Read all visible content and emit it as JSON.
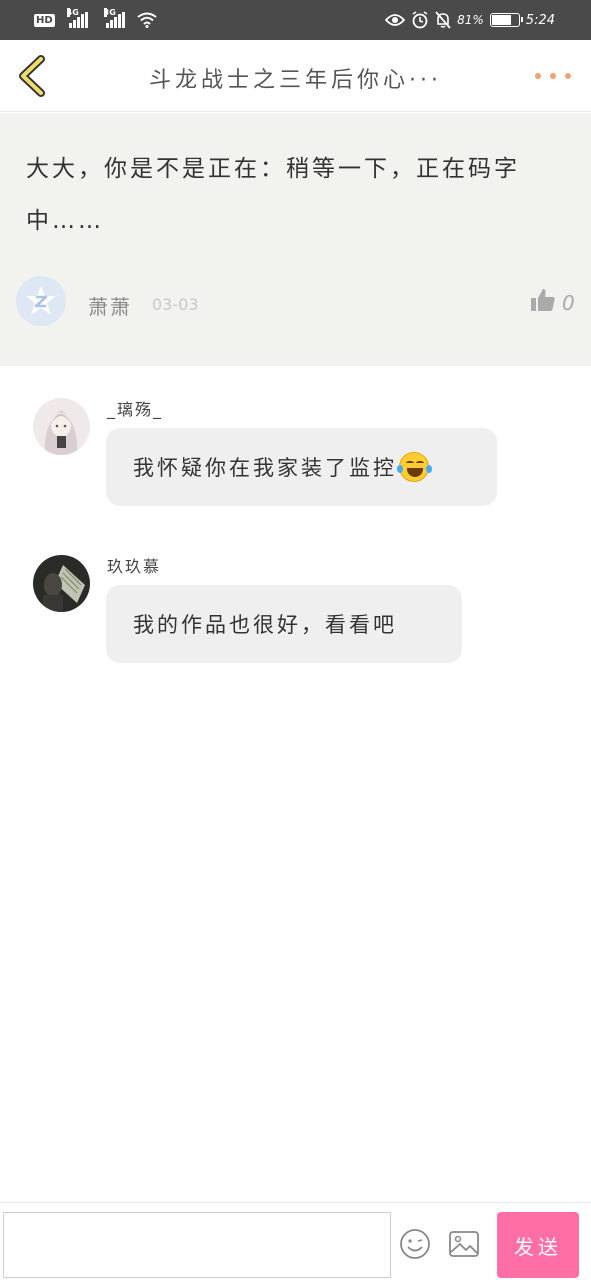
{
  "status_bar": {
    "hd_label": "HD",
    "sim1_network": "4G",
    "sim2_network": "3G",
    "battery_percent_text": "81%",
    "battery_level": 0.81,
    "time": "5:24"
  },
  "header": {
    "title": "斗龙战士之三年后你心···",
    "back_icon": "chevron-left-icon",
    "more_icon": "more-dots-icon",
    "more_color": "#f4a070"
  },
  "post": {
    "text": "大大，你是不是正在：稍等一下，正在码字中……",
    "author": "萧萧",
    "date": "03-03",
    "likes": "0",
    "background": "#f2f2ee"
  },
  "comments": [
    {
      "author": "_璃殇_",
      "text": "我怀疑你在我家装了监控",
      "emoji": "tears-of-joy-emoji"
    },
    {
      "author": "玖玖慕",
      "text": "我的作品也很好，看看吧"
    }
  ],
  "input_bar": {
    "placeholder": "",
    "send_label": "发送",
    "send_color": "#ff6fa6"
  }
}
